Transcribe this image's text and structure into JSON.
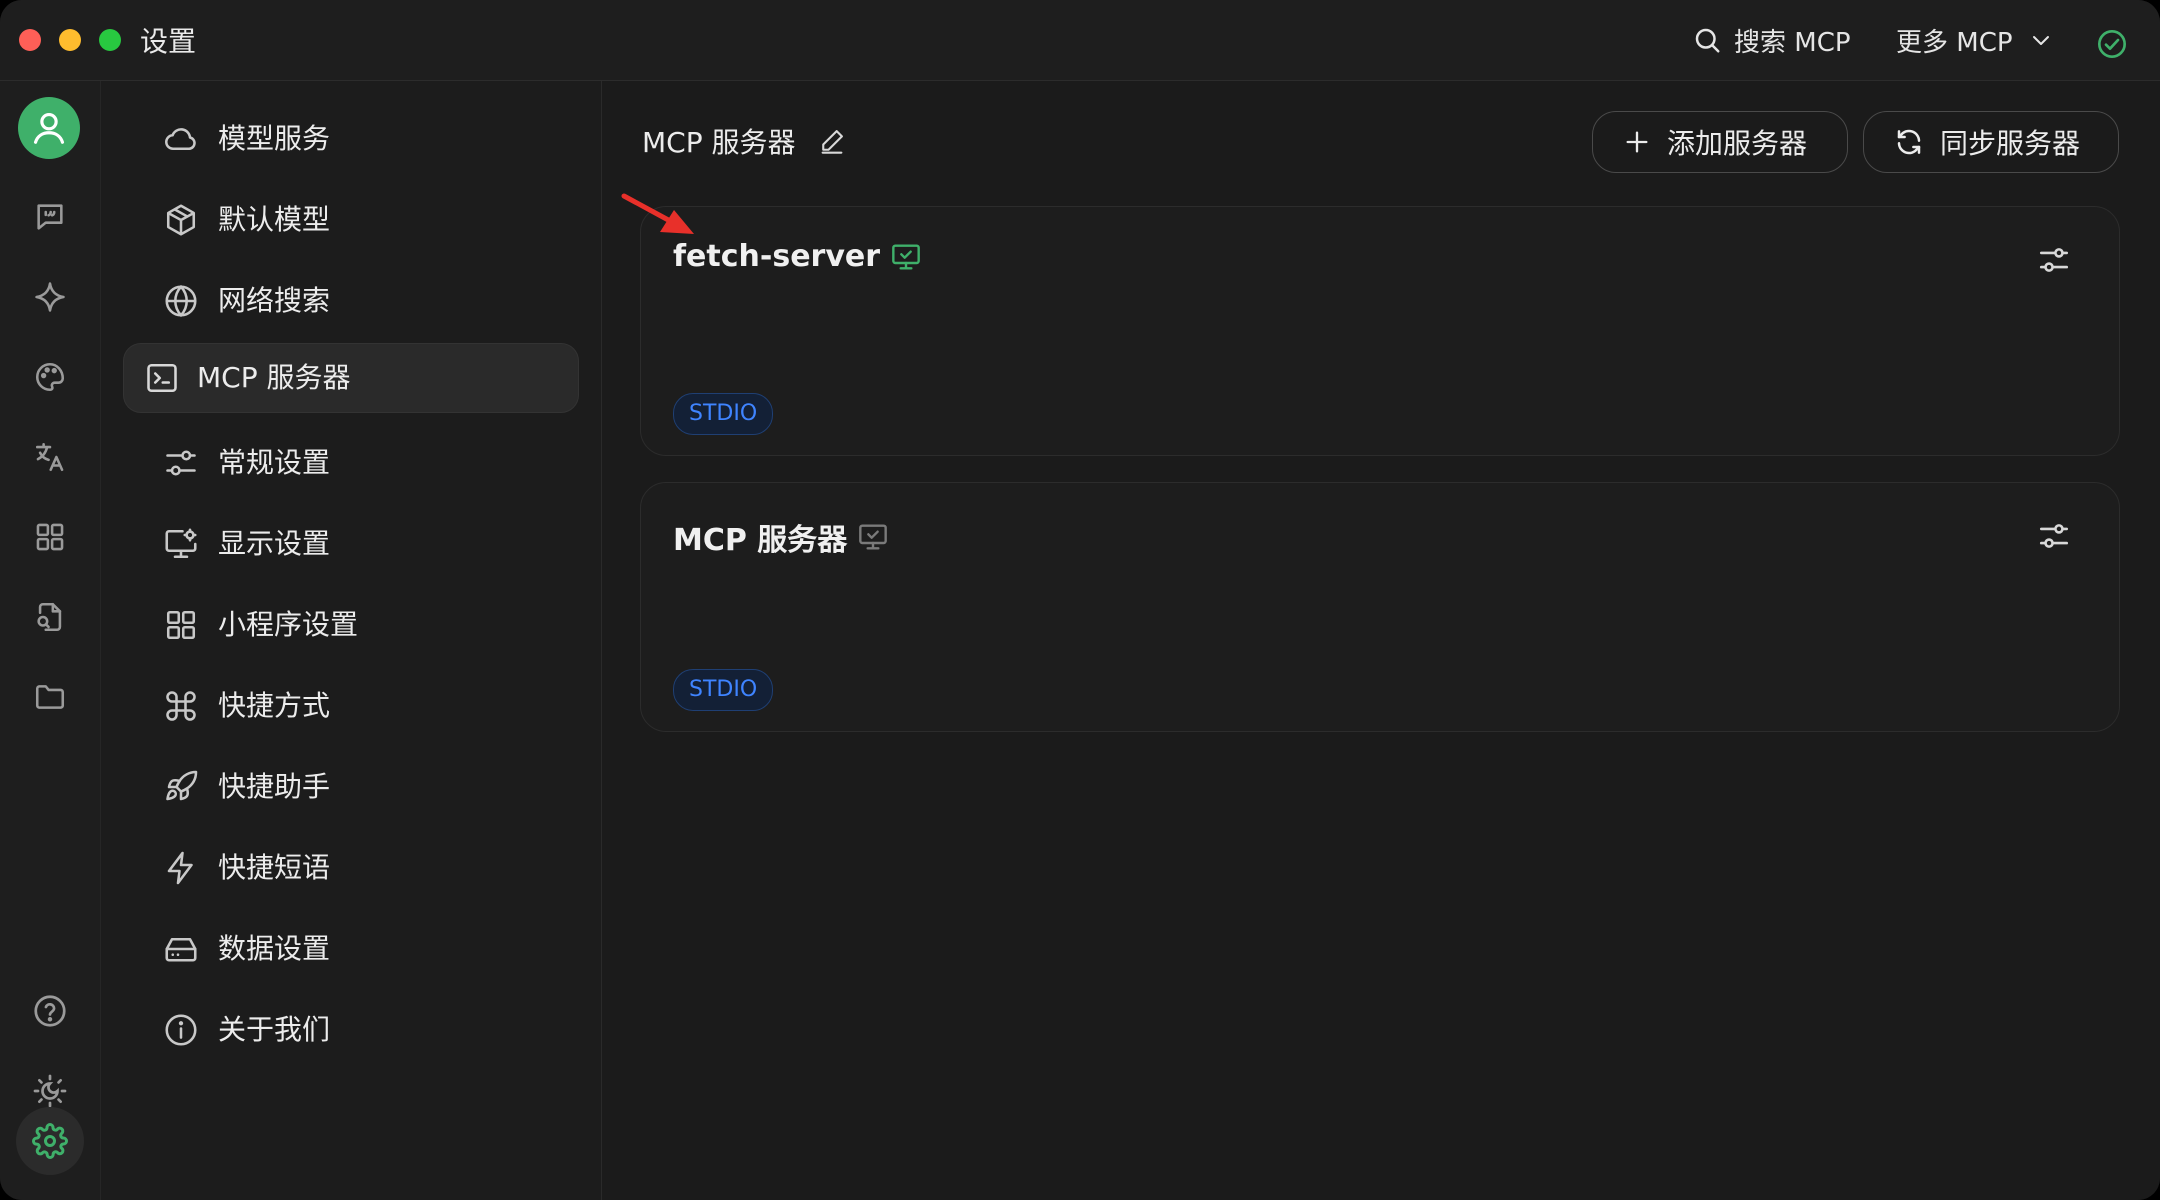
{
  "window": {
    "title": "设置"
  },
  "titlebar": {
    "search_label": "搜索 MCP",
    "more_label": "更多 MCP",
    "status_icon": "check-circle-icon"
  },
  "rail": {
    "items": [
      {
        "icon": "chat-icon"
      },
      {
        "icon": "sparkle-icon"
      },
      {
        "icon": "palette-icon"
      },
      {
        "icon": "translate-icon"
      },
      {
        "icon": "grid-icon"
      },
      {
        "icon": "file-search-icon"
      },
      {
        "icon": "folder-icon"
      }
    ],
    "bottom": [
      {
        "icon": "help-icon"
      },
      {
        "icon": "theme-icon"
      },
      {
        "icon": "settings-icon"
      }
    ]
  },
  "menu": {
    "items": [
      {
        "label": "模型服务",
        "icon": "cloud-icon"
      },
      {
        "label": "默认模型",
        "icon": "cube-icon"
      },
      {
        "label": "网络搜索",
        "icon": "globe-icon"
      },
      {
        "label": "MCP 服务器",
        "icon": "terminal-icon",
        "active": true
      },
      {
        "label": "常规设置",
        "icon": "sliders-icon"
      },
      {
        "label": "显示设置",
        "icon": "monitor-settings-icon"
      },
      {
        "label": "小程序设置",
        "icon": "grid-icon"
      },
      {
        "label": "快捷方式",
        "icon": "command-icon"
      },
      {
        "label": "快捷助手",
        "icon": "rocket-icon"
      },
      {
        "label": "快捷短语",
        "icon": "zap-icon"
      },
      {
        "label": "数据设置",
        "icon": "hard-drive-icon"
      },
      {
        "label": "关于我们",
        "icon": "info-icon"
      }
    ]
  },
  "main": {
    "title": "MCP 服务器",
    "add_button": "添加服务器",
    "sync_button": "同步服务器",
    "servers": [
      {
        "name": "fetch-server",
        "tag": "STDIO",
        "active": true
      },
      {
        "name": "MCP 服务器",
        "tag": "STDIO",
        "active": false
      }
    ]
  },
  "colors": {
    "accent_green": "#3fb06a",
    "tag_blue": "#3f84ff",
    "annotation_red": "#e8302a"
  }
}
